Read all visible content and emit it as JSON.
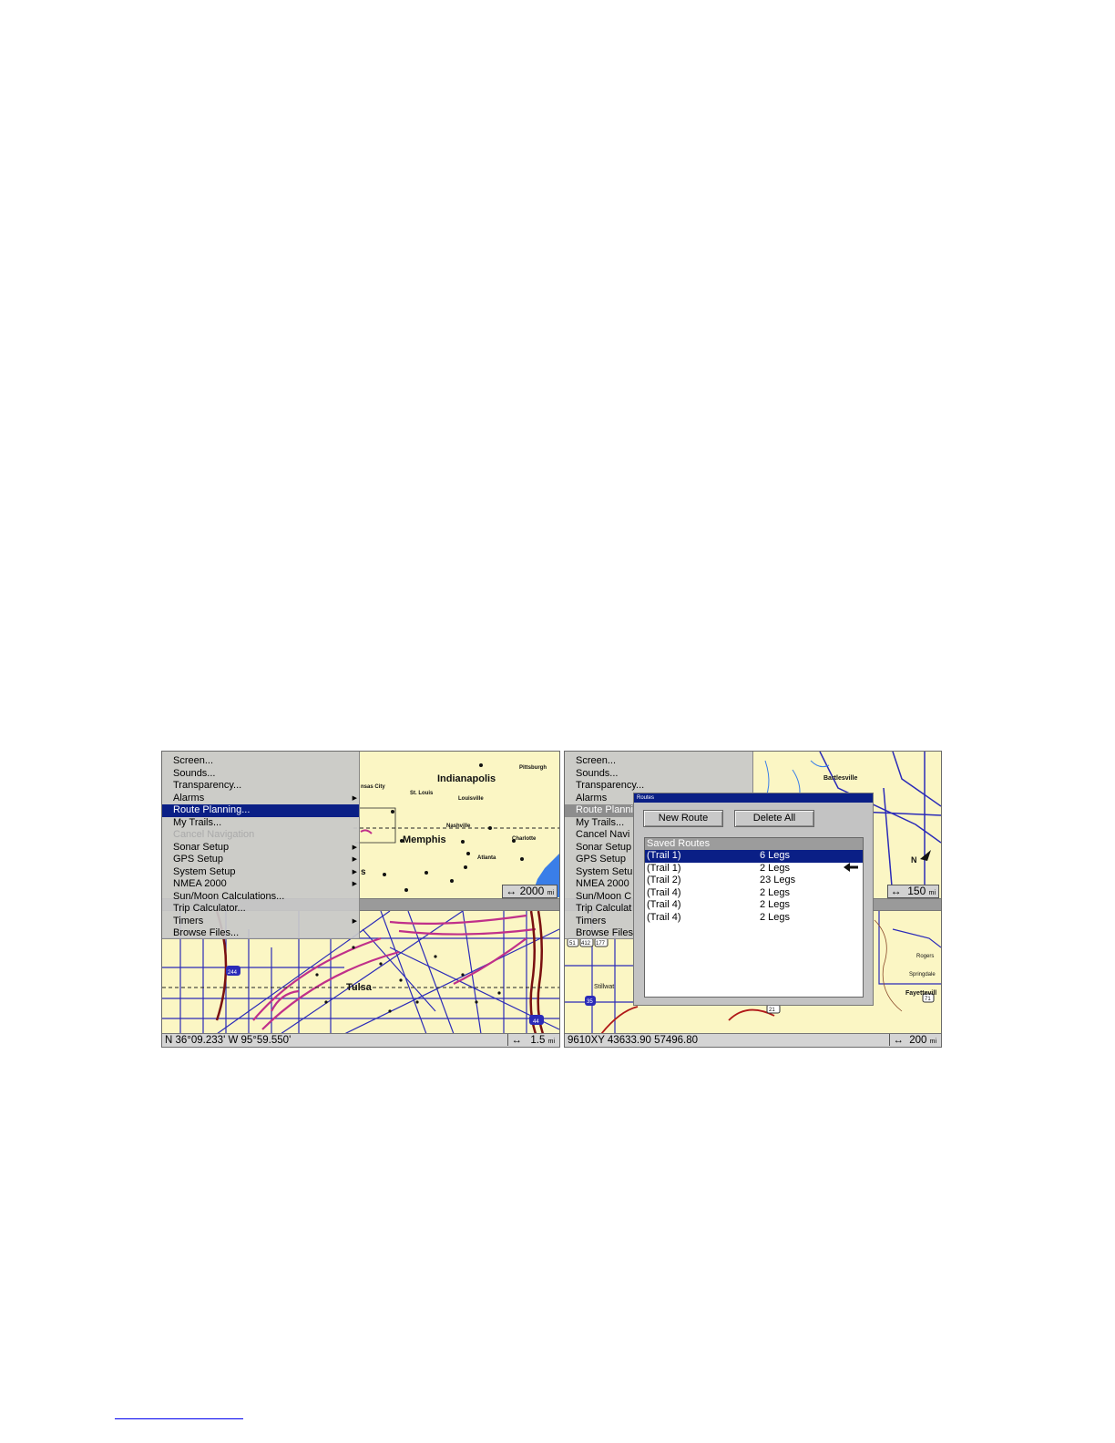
{
  "left_screen": {
    "menu": [
      {
        "label": "Screen..."
      },
      {
        "label": "Sounds..."
      },
      {
        "label": "Transparency..."
      },
      {
        "label": "Alarms",
        "submenu": true
      },
      {
        "label": "Route Planning...",
        "selected": true
      },
      {
        "label": "My Trails..."
      },
      {
        "label": "Cancel Navigation",
        "disabled": true
      },
      {
        "label": "Sonar Setup",
        "submenu": true
      },
      {
        "label": "GPS Setup",
        "submenu": true
      },
      {
        "label": "System Setup",
        "submenu": true
      },
      {
        "label": "NMEA 2000",
        "submenu": true
      },
      {
        "label": "Sun/Moon Calculations..."
      },
      {
        "label": "Trip Calculator..."
      },
      {
        "label": "Timers",
        "submenu": true
      },
      {
        "label": "Browse Files..."
      }
    ],
    "top_map": {
      "city_labels": {
        "indianapolis": "Indianapolis",
        "pittsburgh": "Pittsburgh",
        "kansas_city": "nsas City",
        "st_louis": "St. Louis",
        "louisville": "Louisville",
        "nashville": "Nashville",
        "memphis": "Memphis",
        "charlotte": "Charlotte",
        "atlanta": "Atlanta",
        "fragment_s": "s"
      },
      "scale": "2000",
      "scale_unit": "mi"
    },
    "bottom_map": {
      "city_label": "Tulsa",
      "shields": {
        "s244": "244",
        "s44": "44"
      },
      "coords": "N   36°09.233'   W   95°59.550'",
      "scale": "1.5",
      "scale_unit": "mi"
    },
    "colors": {
      "map_bg": "#fbf6c4",
      "road": "#2b2bb8",
      "rail": "#c0308a",
      "water": "#3a7ee8",
      "highlight": "#0a1f86"
    }
  },
  "right_screen": {
    "menu": [
      {
        "label": "Screen..."
      },
      {
        "label": "Sounds..."
      },
      {
        "label": "Transparency..."
      },
      {
        "label": "Alarms"
      },
      {
        "label": "Route Planni",
        "selected_gray": true
      },
      {
        "label": "My Trails..."
      },
      {
        "label": "Cancel Navi"
      },
      {
        "label": "Sonar Setup"
      },
      {
        "label": "GPS Setup"
      },
      {
        "label": "System Setu"
      },
      {
        "label": "NMEA 2000"
      },
      {
        "label": "Sun/Moon C"
      },
      {
        "label": "Trip Calculat"
      },
      {
        "label": "Timers"
      },
      {
        "label": "Browse Files"
      }
    ],
    "top_map": {
      "city_label": "Bartlesville",
      "north_label": "N",
      "scale": "150",
      "scale_unit": "mi"
    },
    "bottom_map": {
      "city_labels": {
        "fayetteville": "Fayettevill",
        "springdale": "Springdale",
        "rogers": "Rogers",
        "stillwater": "Stillwat"
      },
      "shields": {
        "s51": "51",
        "s412": "412",
        "s177": "177",
        "s35": "35",
        "s21": "21",
        "s71": "71"
      },
      "coords": "9610XY    43633.90    57496.80",
      "scale": "200",
      "scale_unit": "mi"
    },
    "dialog": {
      "title": "Routes",
      "new_route": "New Route",
      "delete_all": "Delete All",
      "saved_routes_header": "Saved Routes",
      "routes": [
        {
          "name": "(Trail 1)",
          "legs": "6 Legs",
          "selected": true
        },
        {
          "name": "(Trail 1)",
          "legs": "2 Legs"
        },
        {
          "name": "(Trail 2)",
          "legs": "23 Legs"
        },
        {
          "name": "(Trail 4)",
          "legs": "2 Legs"
        },
        {
          "name": "(Trail 4)",
          "legs": "2 Legs"
        },
        {
          "name": "(Trail 4)",
          "legs": "2 Legs"
        }
      ]
    }
  },
  "arrow_icon": "left-arrow"
}
